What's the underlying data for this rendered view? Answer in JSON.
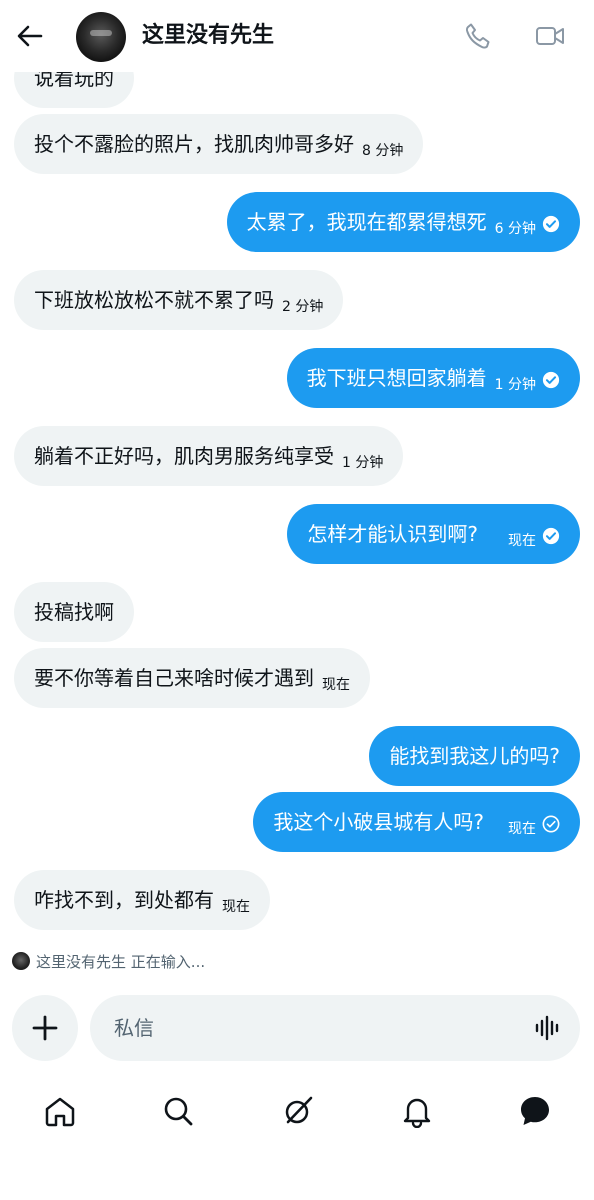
{
  "header": {
    "title": "这里没有先生"
  },
  "messages": [
    {
      "side": "in",
      "text": "说看玩的",
      "time": ""
    },
    {
      "side": "in",
      "text": "投个不露脸的照片，找肌肉帅哥多好",
      "time": "8 分钟"
    },
    {
      "side": "out",
      "text": "太累了，我现在都累得想死",
      "time": "6 分钟",
      "status": "seen"
    },
    {
      "side": "in",
      "text": "下班放松放松不就不累了吗",
      "time": "2 分钟"
    },
    {
      "side": "out",
      "text": "我下班只想回家躺着",
      "time": "1 分钟",
      "status": "seen"
    },
    {
      "side": "in",
      "text": "躺着不正好吗，肌肉男服务纯享受",
      "time": "1 分钟"
    },
    {
      "side": "out",
      "text": "怎样才能认识到啊?",
      "time": "现在",
      "status": "seen"
    },
    {
      "side": "in",
      "text": "投稿找啊",
      "time": ""
    },
    {
      "side": "in",
      "text": "要不你等着自己来啥时候才遇到",
      "time": "现在"
    },
    {
      "side": "out",
      "text": "能找到我这儿的吗?",
      "time": ""
    },
    {
      "side": "out",
      "text": "我这个小破县城有人吗?",
      "time": "现在",
      "status": "sent"
    },
    {
      "side": "in",
      "text": "咋找不到，到处都有",
      "time": "现在"
    }
  ],
  "typing": {
    "name": "这里没有先生",
    "status": "正在输入..."
  },
  "composer": {
    "placeholder": "私信"
  },
  "nav": {
    "icons": [
      "home-icon",
      "search-icon",
      "grok-icon",
      "notifications-icon",
      "messages-icon"
    ]
  },
  "colors": {
    "accent": "#1d9bf0",
    "bubble_in": "#eff3f4",
    "text": "#0f1419",
    "muted": "#536471"
  }
}
